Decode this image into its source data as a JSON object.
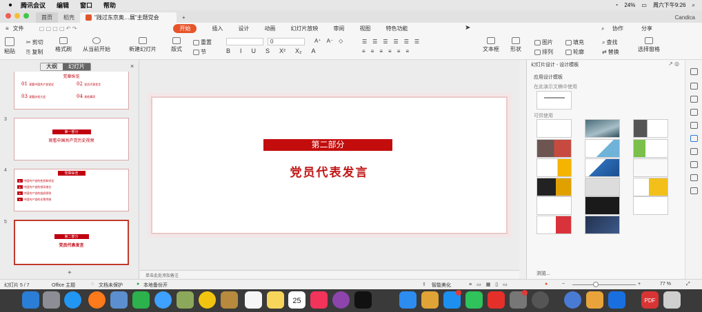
{
  "menubar": {
    "apple": "",
    "app": "腾讯会议",
    "items": [
      "编辑",
      "窗口",
      "帮助"
    ],
    "battery": "24%",
    "clock": "周六下午9:26"
  },
  "tabs": {
    "home": "首页",
    "draft": "稻壳",
    "doc": "\"践过东京奥…展\"主题党会",
    "new": "+",
    "right": "Candica"
  },
  "ribbon_menu": {
    "file": "文件",
    "items": [
      "开始",
      "插入",
      "设计",
      "动画",
      "幻灯片放映",
      "审阅",
      "视图",
      "特色功能"
    ],
    "collab": "协作",
    "share": "分享"
  },
  "toolbar": {
    "paste": "粘贴",
    "cut": "剪切",
    "copy": "复制",
    "format_painter": "格式刷",
    "play_from_current": "从当前开始",
    "new_slide": "新建幻灯片",
    "layout": "版式",
    "reset": "重置",
    "section": "节",
    "font_size": "0",
    "textbox": "文本框",
    "shape": "形状",
    "picture": "图片",
    "arrange": "排列",
    "fill": "填充",
    "outline": "轮廓",
    "find": "查找",
    "replace": "替换",
    "select_pane": "选择窗格"
  },
  "left_panel": {
    "tab_outline": "大纲",
    "tab_slides": "幻灯片",
    "close": "×",
    "thumb2": {
      "title": "党章纵览",
      "items": [
        {
          "num": "01",
          "text": "观看中国共产党党史"
        },
        {
          "num": "02",
          "text": "党员代表发言"
        },
        {
          "num": "03",
          "text": "观看庆祝大会"
        },
        {
          "num": "04",
          "text": "其他事项"
        }
      ]
    },
    "thumb3": {
      "number": "3",
      "header": "第一部分",
      "title": "观看中国共产党历史视频"
    },
    "thumb4": {
      "number": "4",
      "header": "党章纵览",
      "lines": [
        "中国共产党的性质和宗旨",
        "中国共产党的领导地位",
        "中国共产党的组织原则",
        "中国共产党的光荣传统"
      ]
    },
    "thumb5": {
      "number": "5",
      "header": "第二部分",
      "title": "党员代表发言"
    },
    "add": "+"
  },
  "slide": {
    "header": "第二部分",
    "title": "党员代表发言"
  },
  "notes": {
    "placeholder": "单击此处添加备注"
  },
  "right_panel": {
    "title": "幻灯片设计 - 设计模板",
    "subtitle": "应用设计模板",
    "hint": "在此演示文稿中使用",
    "available": "可供使用",
    "browse": "浏览..."
  },
  "status": {
    "slide": "幻灯片 5 / 7",
    "theme": "Office 主题",
    "protect": "文档未保护",
    "backup": "本地备份开",
    "beautify": "智能美化",
    "zoom": "77 %"
  },
  "dock": {
    "calendar_day": "25",
    "pdf": "PDF"
  },
  "colors": {
    "accent": "#e8542a",
    "slide_red": "#c30d0d"
  }
}
